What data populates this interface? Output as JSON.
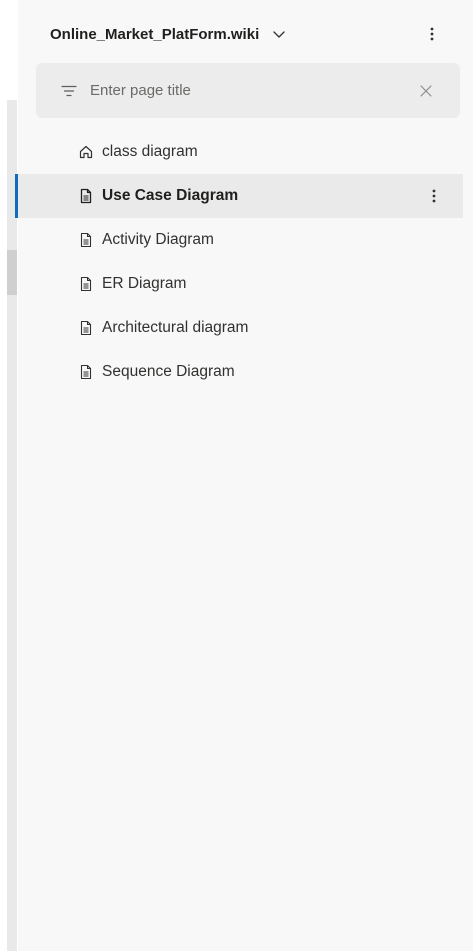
{
  "header": {
    "wiki_name": "Online_Market_PlatForm.wiki",
    "chevron_icon": "chevron-down-icon",
    "more_icon": "more-vertical-icon"
  },
  "search": {
    "placeholder": "Enter page title",
    "value": "",
    "filter_icon": "filter-icon",
    "clear_icon": "close-icon"
  },
  "pages": [
    {
      "label": "class diagram",
      "icon": "home-icon",
      "selected": false
    },
    {
      "label": "Use Case Diagram",
      "icon": "page-icon",
      "selected": true
    },
    {
      "label": "Activity Diagram",
      "icon": "page-icon",
      "selected": false
    },
    {
      "label": "ER Diagram",
      "icon": "page-icon",
      "selected": false
    },
    {
      "label": "Architectural diagram",
      "icon": "page-icon",
      "selected": false
    },
    {
      "label": "Sequence Diagram",
      "icon": "page-icon",
      "selected": false
    }
  ],
  "colors": {
    "accent": "#0f6cbd",
    "selected_background": "#eaeaea",
    "panel_background": "#f8f8f8",
    "search_background": "#ececec"
  }
}
